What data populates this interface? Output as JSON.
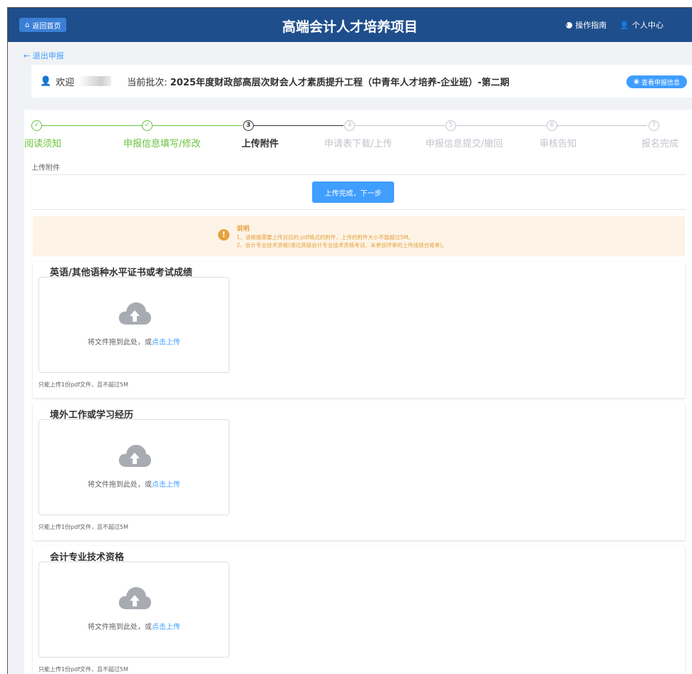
{
  "header": {
    "home_label": "返回首页",
    "title": "高端会计人才培养项目",
    "guide_label": "操作指南",
    "user_label": "个人中心"
  },
  "exit_link": "← 退出申报",
  "welcome": {
    "greeting": "欢迎",
    "batch_prefix": "当前批次:",
    "batch_name": "2025年度财政部高层次财会人才素质提升工程（中青年人才培养-企业班）-第二期",
    "view_button": "查看申报信息"
  },
  "steps": [
    {
      "num": "✓",
      "label": "阅读须知",
      "state": "done"
    },
    {
      "num": "✓",
      "label": "申报信息填写/修改",
      "state": "done"
    },
    {
      "num": "3",
      "label": "上传附件",
      "state": "active"
    },
    {
      "num": "4",
      "label": "申请表下载/上传",
      "state": "pending"
    },
    {
      "num": "5",
      "label": "申报信息提交/撤回",
      "state": "pending"
    },
    {
      "num": "6",
      "label": "审核告知",
      "state": "pending"
    },
    {
      "num": "7",
      "label": "报名完成",
      "state": "pending"
    }
  ],
  "sub_label": "上传附件",
  "next_button": "上传完成，下一步",
  "notice": {
    "title": "说明",
    "line1": "1、请根据需要上传对应的.pdf格式的附件，上传的附件大小不能超过5M。",
    "line2": "2、会计专业技术资格(通过高级会计专业技术资格考试、未参加评审的上传成绩合格单)。"
  },
  "sections": [
    {
      "title": "英语/其他语种水平证书或考试成绩",
      "drop_text": "将文件拖到此处，或",
      "click_text": "点击上传",
      "tip": "只能上传1份pdf文件，且不超过5M"
    },
    {
      "title": "境外工作或学习经历",
      "drop_text": "将文件拖到此处，或",
      "click_text": "点击上传",
      "tip": "只能上传1份pdf文件，且不超过5M"
    },
    {
      "title": "会计专业技术资格",
      "drop_text": "将文件拖到此处，或",
      "click_text": "点击上传",
      "tip": "只能上传1份pdf文件，且不超过5M"
    }
  ],
  "colors": {
    "header_bg": "#1f4e8c",
    "primary": "#409eff",
    "success": "#67c23a",
    "warning": "#e6a23c",
    "notice_bg": "#fdf3e6"
  }
}
